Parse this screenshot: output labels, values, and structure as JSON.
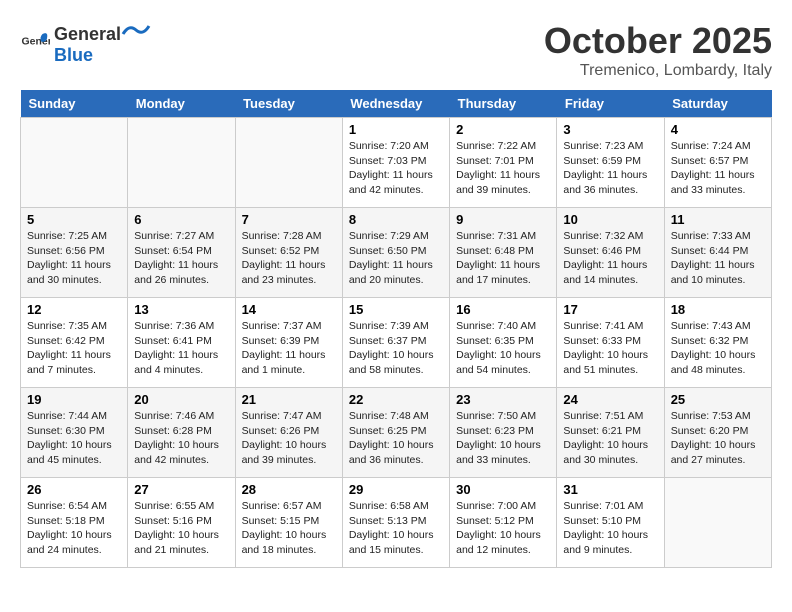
{
  "header": {
    "logo_general": "General",
    "logo_blue": "Blue",
    "month": "October 2025",
    "location": "Tremenico, Lombardy, Italy"
  },
  "days_of_week": [
    "Sunday",
    "Monday",
    "Tuesday",
    "Wednesday",
    "Thursday",
    "Friday",
    "Saturday"
  ],
  "weeks": [
    [
      {
        "day": "",
        "info": ""
      },
      {
        "day": "",
        "info": ""
      },
      {
        "day": "",
        "info": ""
      },
      {
        "day": "1",
        "info": "Sunrise: 7:20 AM\nSunset: 7:03 PM\nDaylight: 11 hours and 42 minutes."
      },
      {
        "day": "2",
        "info": "Sunrise: 7:22 AM\nSunset: 7:01 PM\nDaylight: 11 hours and 39 minutes."
      },
      {
        "day": "3",
        "info": "Sunrise: 7:23 AM\nSunset: 6:59 PM\nDaylight: 11 hours and 36 minutes."
      },
      {
        "day": "4",
        "info": "Sunrise: 7:24 AM\nSunset: 6:57 PM\nDaylight: 11 hours and 33 minutes."
      }
    ],
    [
      {
        "day": "5",
        "info": "Sunrise: 7:25 AM\nSunset: 6:56 PM\nDaylight: 11 hours and 30 minutes."
      },
      {
        "day": "6",
        "info": "Sunrise: 7:27 AM\nSunset: 6:54 PM\nDaylight: 11 hours and 26 minutes."
      },
      {
        "day": "7",
        "info": "Sunrise: 7:28 AM\nSunset: 6:52 PM\nDaylight: 11 hours and 23 minutes."
      },
      {
        "day": "8",
        "info": "Sunrise: 7:29 AM\nSunset: 6:50 PM\nDaylight: 11 hours and 20 minutes."
      },
      {
        "day": "9",
        "info": "Sunrise: 7:31 AM\nSunset: 6:48 PM\nDaylight: 11 hours and 17 minutes."
      },
      {
        "day": "10",
        "info": "Sunrise: 7:32 AM\nSunset: 6:46 PM\nDaylight: 11 hours and 14 minutes."
      },
      {
        "day": "11",
        "info": "Sunrise: 7:33 AM\nSunset: 6:44 PM\nDaylight: 11 hours and 10 minutes."
      }
    ],
    [
      {
        "day": "12",
        "info": "Sunrise: 7:35 AM\nSunset: 6:42 PM\nDaylight: 11 hours and 7 minutes."
      },
      {
        "day": "13",
        "info": "Sunrise: 7:36 AM\nSunset: 6:41 PM\nDaylight: 11 hours and 4 minutes."
      },
      {
        "day": "14",
        "info": "Sunrise: 7:37 AM\nSunset: 6:39 PM\nDaylight: 11 hours and 1 minute."
      },
      {
        "day": "15",
        "info": "Sunrise: 7:39 AM\nSunset: 6:37 PM\nDaylight: 10 hours and 58 minutes."
      },
      {
        "day": "16",
        "info": "Sunrise: 7:40 AM\nSunset: 6:35 PM\nDaylight: 10 hours and 54 minutes."
      },
      {
        "day": "17",
        "info": "Sunrise: 7:41 AM\nSunset: 6:33 PM\nDaylight: 10 hours and 51 minutes."
      },
      {
        "day": "18",
        "info": "Sunrise: 7:43 AM\nSunset: 6:32 PM\nDaylight: 10 hours and 48 minutes."
      }
    ],
    [
      {
        "day": "19",
        "info": "Sunrise: 7:44 AM\nSunset: 6:30 PM\nDaylight: 10 hours and 45 minutes."
      },
      {
        "day": "20",
        "info": "Sunrise: 7:46 AM\nSunset: 6:28 PM\nDaylight: 10 hours and 42 minutes."
      },
      {
        "day": "21",
        "info": "Sunrise: 7:47 AM\nSunset: 6:26 PM\nDaylight: 10 hours and 39 minutes."
      },
      {
        "day": "22",
        "info": "Sunrise: 7:48 AM\nSunset: 6:25 PM\nDaylight: 10 hours and 36 minutes."
      },
      {
        "day": "23",
        "info": "Sunrise: 7:50 AM\nSunset: 6:23 PM\nDaylight: 10 hours and 33 minutes."
      },
      {
        "day": "24",
        "info": "Sunrise: 7:51 AM\nSunset: 6:21 PM\nDaylight: 10 hours and 30 minutes."
      },
      {
        "day": "25",
        "info": "Sunrise: 7:53 AM\nSunset: 6:20 PM\nDaylight: 10 hours and 27 minutes."
      }
    ],
    [
      {
        "day": "26",
        "info": "Sunrise: 6:54 AM\nSunset: 5:18 PM\nDaylight: 10 hours and 24 minutes."
      },
      {
        "day": "27",
        "info": "Sunrise: 6:55 AM\nSunset: 5:16 PM\nDaylight: 10 hours and 21 minutes."
      },
      {
        "day": "28",
        "info": "Sunrise: 6:57 AM\nSunset: 5:15 PM\nDaylight: 10 hours and 18 minutes."
      },
      {
        "day": "29",
        "info": "Sunrise: 6:58 AM\nSunset: 5:13 PM\nDaylight: 10 hours and 15 minutes."
      },
      {
        "day": "30",
        "info": "Sunrise: 7:00 AM\nSunset: 5:12 PM\nDaylight: 10 hours and 12 minutes."
      },
      {
        "day": "31",
        "info": "Sunrise: 7:01 AM\nSunset: 5:10 PM\nDaylight: 10 hours and 9 minutes."
      },
      {
        "day": "",
        "info": ""
      }
    ]
  ]
}
